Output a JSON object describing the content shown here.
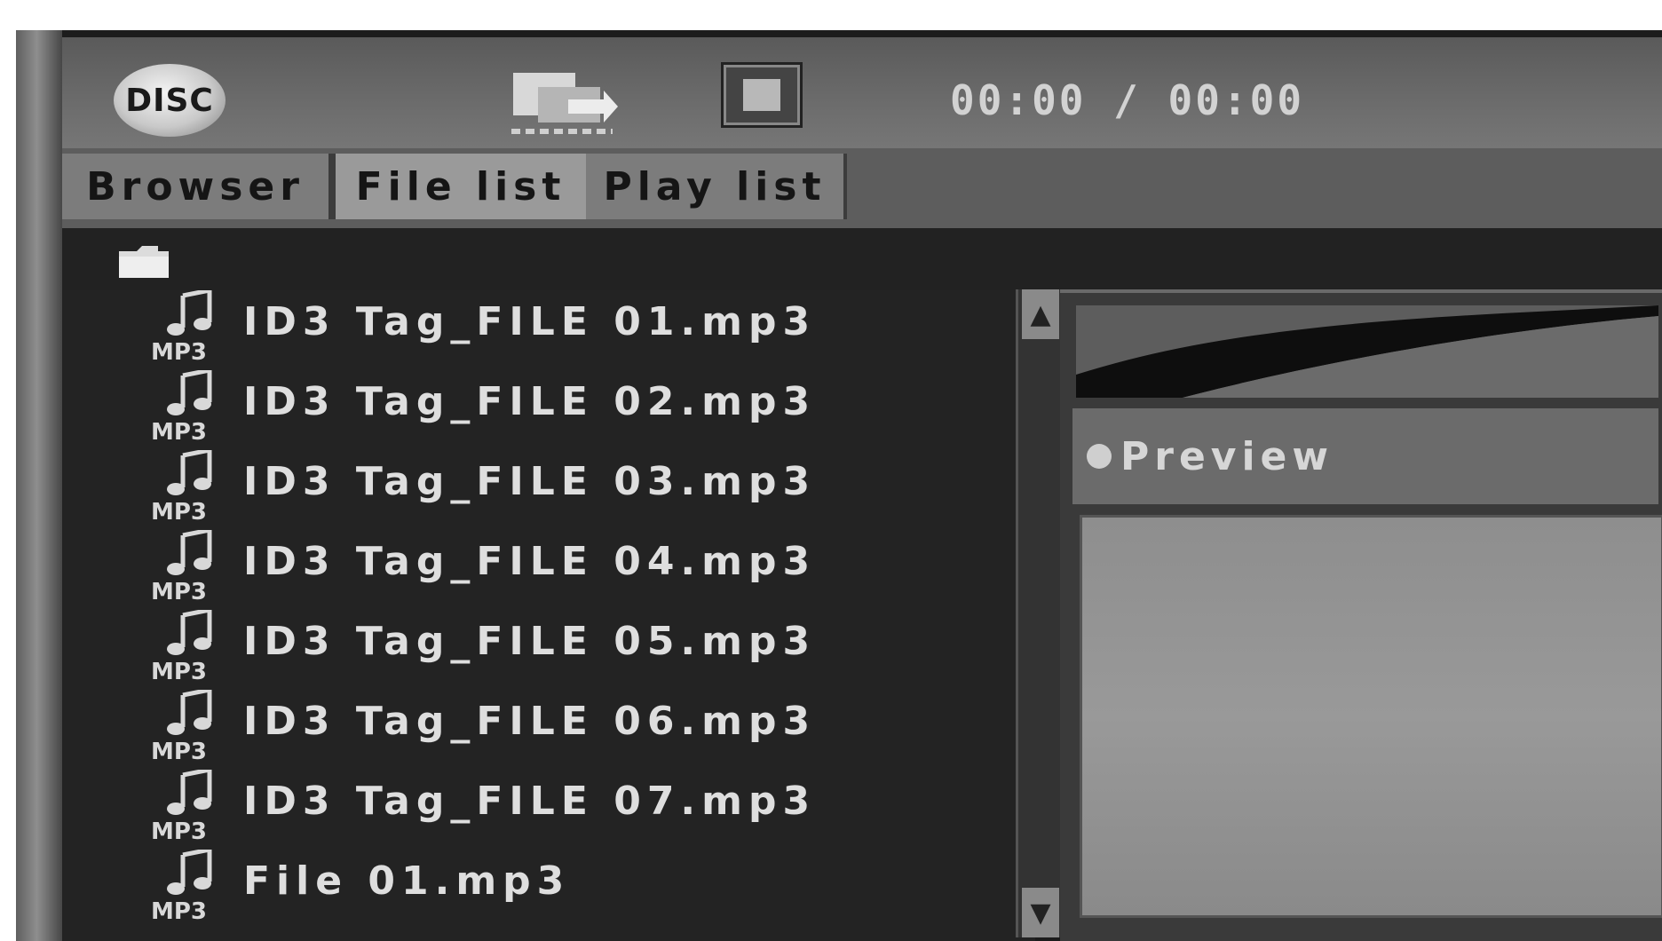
{
  "header": {
    "logo_text": "DISC",
    "time": "00:00 / 00:00"
  },
  "tabs": [
    {
      "label": "Browser"
    },
    {
      "label": "File list",
      "active": true
    },
    {
      "label": "Play list"
    }
  ],
  "file_list": {
    "items": [
      {
        "name": "ID3 Tag_FILE 01.mp3"
      },
      {
        "name": "ID3 Tag_FILE 02.mp3"
      },
      {
        "name": "ID3 Tag_FILE 03.mp3"
      },
      {
        "name": "ID3 Tag_FILE 04.mp3"
      },
      {
        "name": "ID3 Tag_FILE 05.mp3"
      },
      {
        "name": "ID3 Tag_FILE 06.mp3"
      },
      {
        "name": "ID3 Tag_FILE 07.mp3"
      },
      {
        "name": "File 01.mp3"
      }
    ]
  },
  "preview": {
    "label": "Preview"
  },
  "icons": {
    "logo": "disc-logo-icon",
    "transfer": "transfer-icon",
    "stop": "stop-icon",
    "folder": "folder-icon",
    "file": "mp3-file-icon"
  }
}
